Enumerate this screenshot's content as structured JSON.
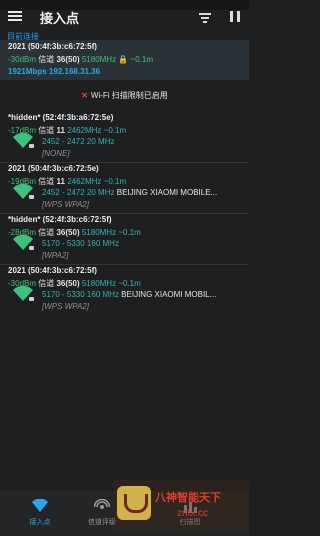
{
  "app": {
    "title": "接入点"
  },
  "colors": {
    "background": "#1e1f20",
    "accent": "#29a8e0",
    "signal_green": "#3fc07d",
    "warning_red": "#e0483e"
  },
  "connected": {
    "header": "目前连接",
    "ssid": "2021 (50:4f:3b:c6:72:5f)",
    "rssi": "-30dBm",
    "channel_label": "信道",
    "channel": "36(50)",
    "frequency": "5180MHz",
    "distance": "~0.1m",
    "speed": "1921Mbps",
    "ip": "192.168.31.36"
  },
  "warning": {
    "icon": "x-icon",
    "text": "Wi-Fi 扫描限制已启用"
  },
  "access_points": [
    {
      "ssid": "*hidden* (52:4f:3b:a6:72:5e)",
      "rssi": "-17dBm",
      "channel_label": "信道",
      "channel": "11",
      "frequency": "2462MHz",
      "distance": "~0.1m",
      "range": "2452 - 2472 20 MHz",
      "vendor": "",
      "security": "[NONE]"
    },
    {
      "ssid": "2021 (50:4f:3b:c6:72:5e)",
      "rssi": "-19dBm",
      "channel_label": "信道",
      "channel": "11",
      "frequency": "2462MHz",
      "distance": "~0.1m",
      "range": "2452 - 2472 20 MHz",
      "vendor": "BEIJING XIAOMI MOBILE...",
      "security": "[WPS WPA2]"
    },
    {
      "ssid": "*hidden* (52:4f:3b:c6:72:5f)",
      "rssi": "-28dBm",
      "channel_label": "信道",
      "channel": "36(50)",
      "frequency": "5180MHz",
      "distance": "~0.1m",
      "range": "5170 - 5330 160 MHz",
      "vendor": "",
      "security": "[WPA2]"
    },
    {
      "ssid": "2021 (50:4f:3b:c6:72:5f)",
      "rssi": "-30dBm",
      "channel_label": "信道",
      "channel": "36(50)",
      "frequency": "5180MHz",
      "distance": "~0.1m",
      "range": "5170 - 5330 160 MHz",
      "vendor": "BEIJING XIAOMI MOBIL...",
      "security": "[WPS WPA2]"
    }
  ],
  "bottom_nav": [
    {
      "label": "接入点",
      "icon": "wifi-icon",
      "active": true
    },
    {
      "label": "信道评级",
      "icon": "signal-icon",
      "active": false
    },
    {
      "label": "扫描图",
      "icon": "chart-icon",
      "active": false
    }
  ],
  "watermark": {
    "line1": "八神智能天下",
    "line2": "zntx.cc"
  }
}
